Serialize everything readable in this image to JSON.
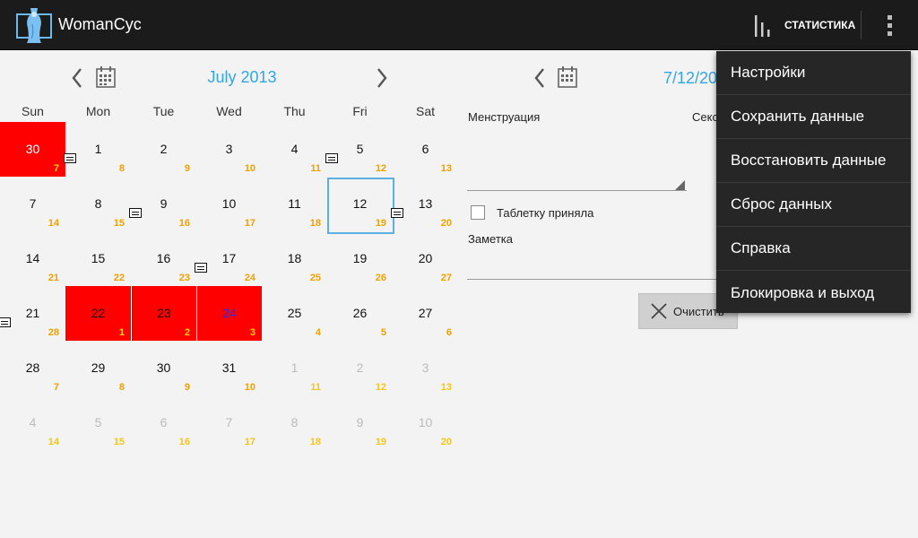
{
  "app": {
    "title": "WomanCyc"
  },
  "actionbar": {
    "stats_label": "СТАТИСТИКА",
    "overflow_icon": "overflow-menu-icon"
  },
  "calendar": {
    "month_title": "July 2013",
    "weekdays": [
      "Sun",
      "Mon",
      "Tue",
      "Wed",
      "Thu",
      "Fri",
      "Sat"
    ],
    "selected_day": "12",
    "period_color": "#ff0000",
    "accent_color": "#33a5e0",
    "rows": [
      [
        {
          "day": "30",
          "cycle": "7",
          "other": true,
          "period": true
        },
        {
          "day": "1",
          "cycle": "8",
          "note": true
        },
        {
          "day": "2",
          "cycle": "9"
        },
        {
          "day": "3",
          "cycle": "10"
        },
        {
          "day": "4",
          "cycle": "11"
        },
        {
          "day": "5",
          "cycle": "12",
          "note": true
        },
        {
          "day": "6",
          "cycle": "13"
        }
      ],
      [
        {
          "day": "7",
          "cycle": "14"
        },
        {
          "day": "8",
          "cycle": "15"
        },
        {
          "day": "9",
          "cycle": "16",
          "note": true
        },
        {
          "day": "10",
          "cycle": "17"
        },
        {
          "day": "11",
          "cycle": "18"
        },
        {
          "day": "12",
          "cycle": "19",
          "selected": true
        },
        {
          "day": "13",
          "cycle": "20",
          "note": true
        }
      ],
      [
        {
          "day": "14",
          "cycle": "21"
        },
        {
          "day": "15",
          "cycle": "22"
        },
        {
          "day": "16",
          "cycle": "23"
        },
        {
          "day": "17",
          "cycle": "24",
          "note": true
        },
        {
          "day": "18",
          "cycle": "25"
        },
        {
          "day": "19",
          "cycle": "26"
        },
        {
          "day": "20",
          "cycle": "27"
        }
      ],
      [
        {
          "day": "21",
          "cycle": "28",
          "note": true
        },
        {
          "day": "22",
          "cycle": "1",
          "period": true,
          "dark": true
        },
        {
          "day": "23",
          "cycle": "2",
          "period": true,
          "dark": true
        },
        {
          "day": "24",
          "cycle": "3",
          "period": true,
          "blue": true
        },
        {
          "day": "25",
          "cycle": "4"
        },
        {
          "day": "26",
          "cycle": "5"
        },
        {
          "day": "27",
          "cycle": "6"
        }
      ],
      [
        {
          "day": "28",
          "cycle": "7"
        },
        {
          "day": "29",
          "cycle": "8"
        },
        {
          "day": "30",
          "cycle": "9"
        },
        {
          "day": "31",
          "cycle": "10"
        },
        {
          "day": "1",
          "cycle": "11",
          "other": true
        },
        {
          "day": "2",
          "cycle": "12",
          "other": true
        },
        {
          "day": "3",
          "cycle": "13",
          "other": true
        }
      ],
      [
        {
          "day": "4",
          "cycle": "14",
          "other": true
        },
        {
          "day": "5",
          "cycle": "15",
          "other": true
        },
        {
          "day": "6",
          "cycle": "16",
          "other": true
        },
        {
          "day": "7",
          "cycle": "17",
          "other": true
        },
        {
          "day": "8",
          "cycle": "18",
          "other": true
        },
        {
          "day": "9",
          "cycle": "19",
          "other": true
        },
        {
          "day": "10",
          "cycle": "20",
          "other": true
        }
      ]
    ]
  },
  "detail": {
    "date": "7/12/20",
    "menstruation_label": "Менструация",
    "second_label": "Секс",
    "pill_label": "Таблетку приняла",
    "note_label": "Заметка",
    "note_value": "",
    "clear_label": "Очистить"
  },
  "menu": {
    "items": [
      "Настройки",
      "Сохранить данные",
      "Восстановить данные",
      "Сброс данных",
      "Справка",
      "Блокировка и выход"
    ]
  }
}
